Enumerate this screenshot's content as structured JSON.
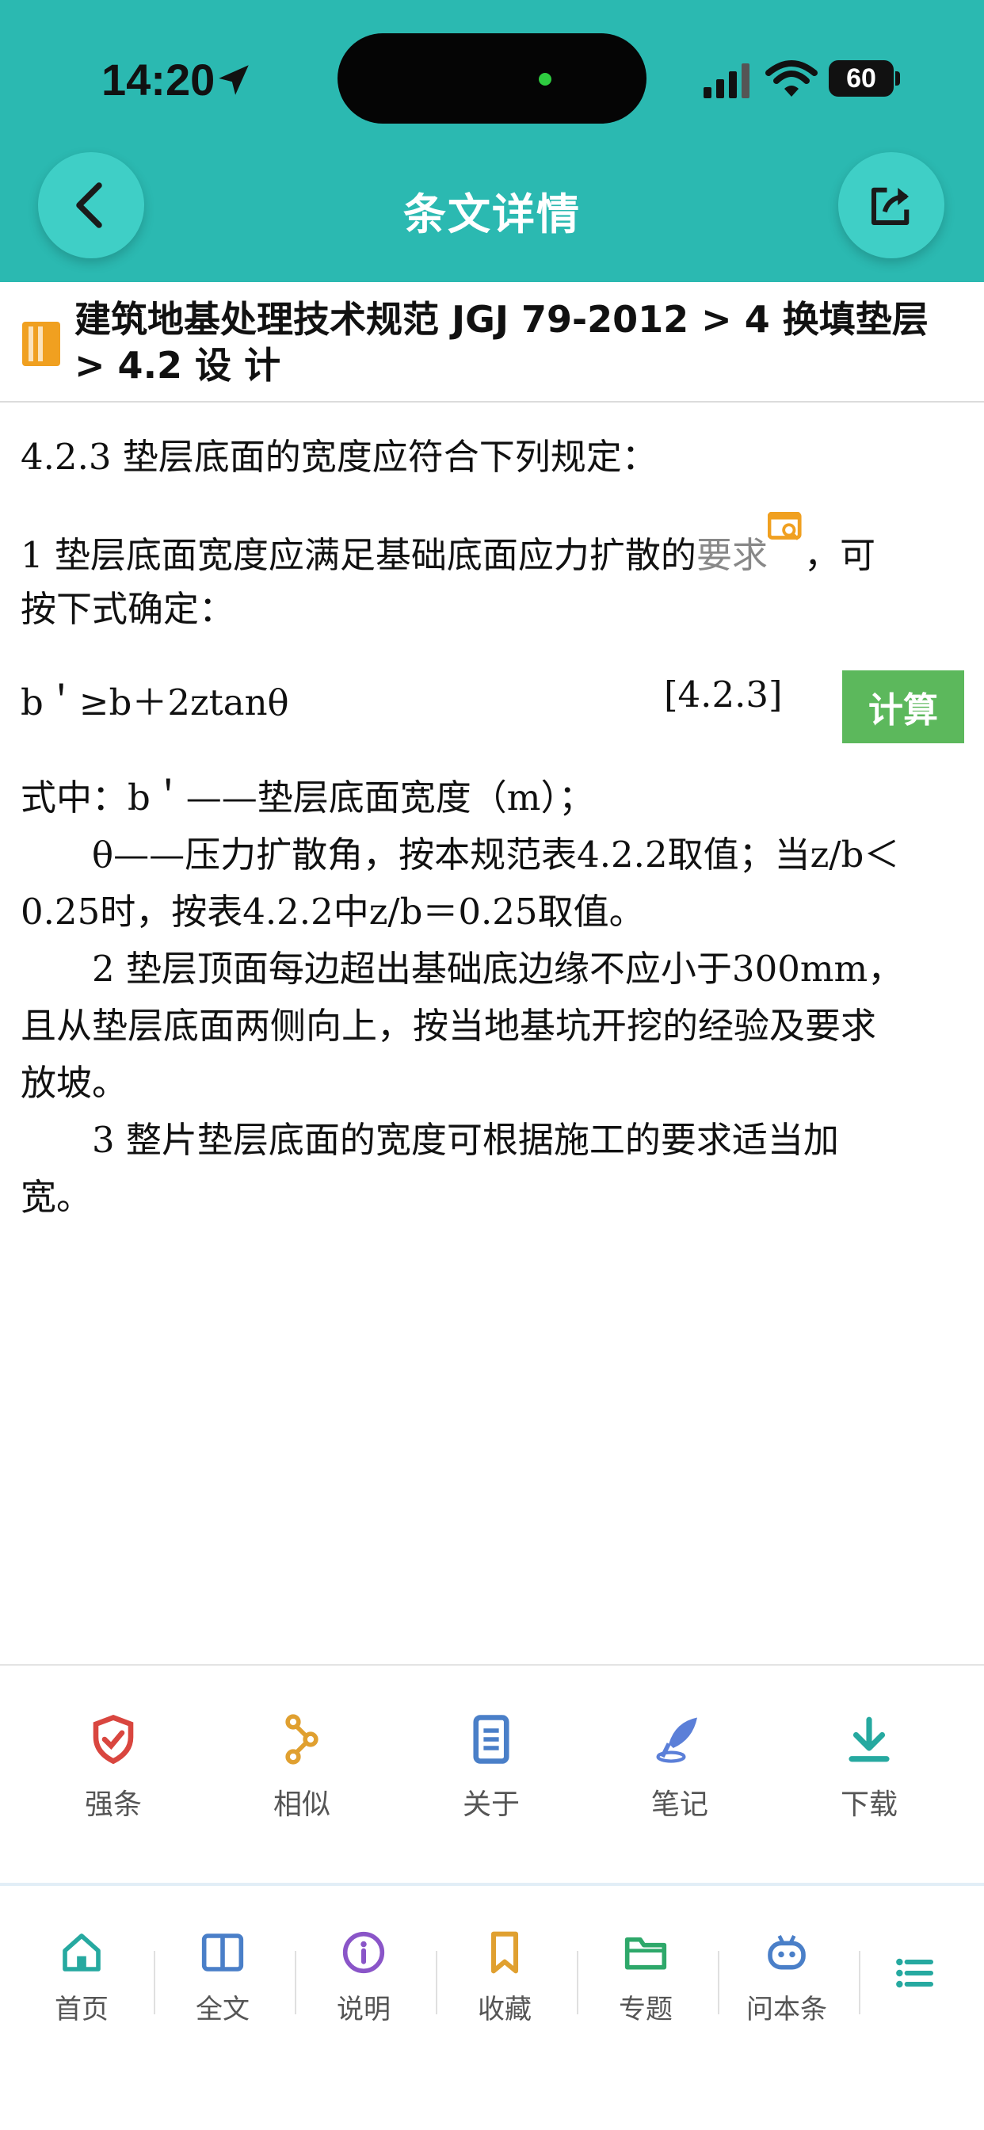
{
  "status_bar": {
    "time": "14:20",
    "battery": "60"
  },
  "header": {
    "title": "条文详情"
  },
  "breadcrumb": {
    "line1": "建筑地基处理技术规范 JGJ 79-2012 > 4 换填垫层",
    "line2": "> 4.2 设 计"
  },
  "content": {
    "p1": "4.2.3 垫层底面的宽度应符合下列规定：",
    "p2_pre": "1 垫层底面宽度应满足基础底面应力扩散的",
    "p2_link": "要求",
    "p2_post": "，可",
    "p3": "按下式确定：",
    "formula": "b＇≥b＋2ztanθ",
    "formula_no": "[4.2.3]",
    "calc_label": "计算",
    "p4": "式中：b＇——垫层底面宽度（m）；",
    "p5": "　　θ——压力扩散角，按本规范表4.2.2取值；当z/b＜",
    "p6": "0.25时，按表4.2.2中z/b＝0.25取值。",
    "p7": "　　2 垫层顶面每边超出基础底边缘不应小于300mm，",
    "p8": "且从垫层底面两侧向上，按当地基坑开挖的经验及要求",
    "p9": "放坡。",
    "p10": "　　3 整片垫层底面的宽度可根据施工的要求适当加",
    "p11": "宽。"
  },
  "toolbar": {
    "items": [
      {
        "label": "强条",
        "icon": "shield-check-icon",
        "color": "#d9463f"
      },
      {
        "label": "相似",
        "icon": "share-nodes-icon",
        "color": "#e0a030"
      },
      {
        "label": "关于",
        "icon": "document-icon",
        "color": "#4a7fc8"
      },
      {
        "label": "笔记",
        "icon": "quill-icon",
        "color": "#5b7fd8"
      },
      {
        "label": "下载",
        "icon": "download-icon",
        "color": "#26a9a0"
      }
    ]
  },
  "tabbar": {
    "items": [
      {
        "label": "首页",
        "icon": "home-icon",
        "color": "#26a9a0"
      },
      {
        "label": "全文",
        "icon": "book-open-icon",
        "color": "#4a7fc8"
      },
      {
        "label": "说明",
        "icon": "info-icon",
        "color": "#8a55c8"
      },
      {
        "label": "收藏",
        "icon": "bookmark-icon",
        "color": "#e0a030"
      },
      {
        "label": "专题",
        "icon": "folder-icon",
        "color": "#2ea86a"
      },
      {
        "label": "问本条",
        "icon": "robot-icon",
        "color": "#4a7fc8"
      },
      {
        "label": "",
        "icon": "list-icon",
        "color": "#26a9a0"
      }
    ]
  }
}
